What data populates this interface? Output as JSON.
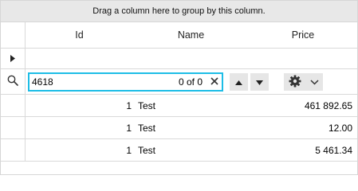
{
  "group_panel": {
    "text": "Drag a column here to group by this column."
  },
  "columns": [
    {
      "label": "Id"
    },
    {
      "label": "Name"
    },
    {
      "label": "Price"
    }
  ],
  "search": {
    "value": "4618",
    "match_count": "0 of 0"
  },
  "icons": {
    "new_row": "triangle-right-icon",
    "search": "magnifier-icon",
    "clear": "close-icon",
    "prev": "arrow-up-icon",
    "next": "arrow-down-icon",
    "options": "gear-icon",
    "options_dropdown": "chevron-down-icon"
  },
  "rows": [
    {
      "id": "1",
      "name": "Test",
      "price": "461 892.65"
    },
    {
      "id": "1",
      "name": "Test",
      "price": "12.00"
    },
    {
      "id": "1",
      "name": "Test",
      "price": "5 461.34"
    }
  ],
  "colors": {
    "search_border": "#1dbde6",
    "group_panel_bg": "#e8e8e8",
    "button_bg": "#e6e6e6"
  }
}
